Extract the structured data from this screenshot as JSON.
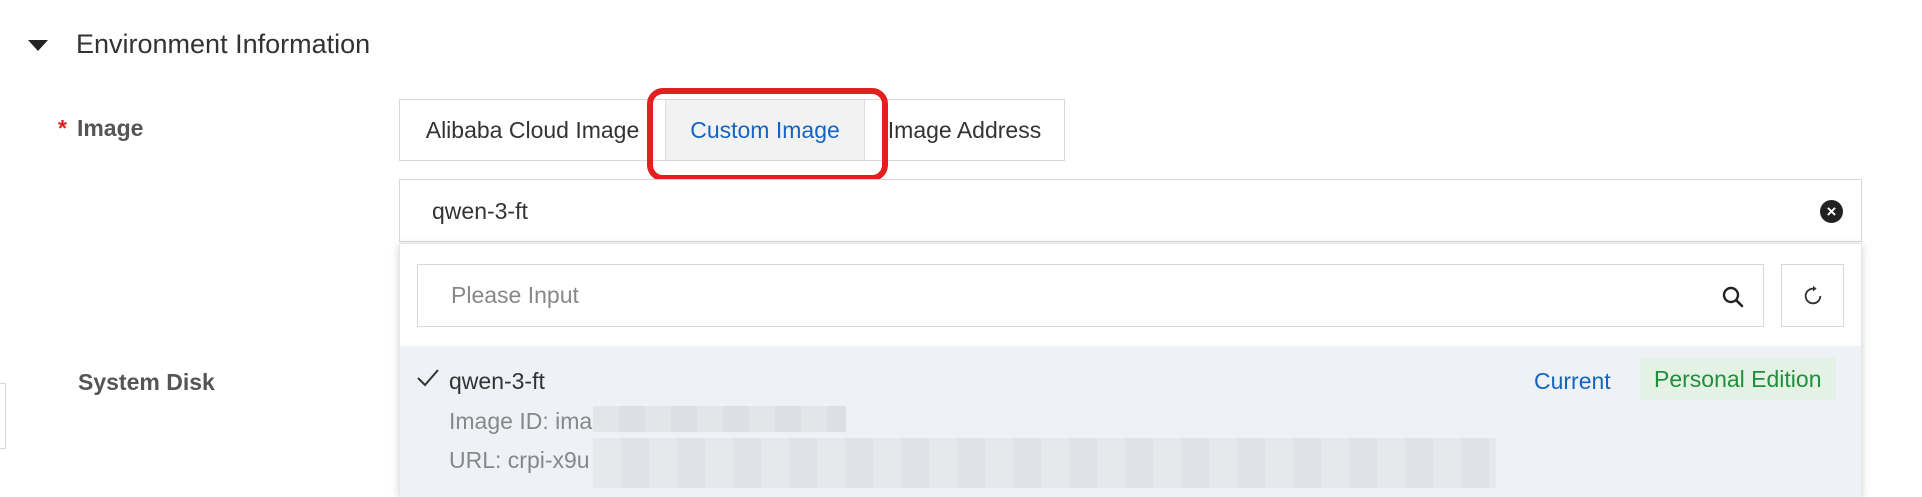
{
  "section": {
    "title": "Environment Information"
  },
  "form": {
    "image_label": "Image",
    "required_mark": "*",
    "system_disk_label": "System Disk"
  },
  "tabs": [
    {
      "label": "Alibaba Cloud Image",
      "selected": false
    },
    {
      "label": "Custom Image",
      "selected": true
    },
    {
      "label": "Image Address",
      "selected": false
    }
  ],
  "image_select": {
    "value": "qwen-3-ft",
    "clear_icon": "close-circle-icon"
  },
  "dropdown": {
    "search_placeholder": "Please Input",
    "search_icon": "search-icon",
    "refresh_icon": "refresh-icon",
    "options": [
      {
        "name": "qwen-3-ft",
        "selected": true,
        "id_line": "Image ID: ima",
        "url_line": "URL: crpi-x9u",
        "current_label": "Current",
        "edition_label": "Personal Edition"
      }
    ]
  },
  "colors": {
    "accent": "#1565c0",
    "required": "#e02020",
    "highlight": "#e32020",
    "edition_text": "#1f8f3a",
    "edition_bg": "#e4f2e6",
    "option_bg": "#eef1f6"
  }
}
